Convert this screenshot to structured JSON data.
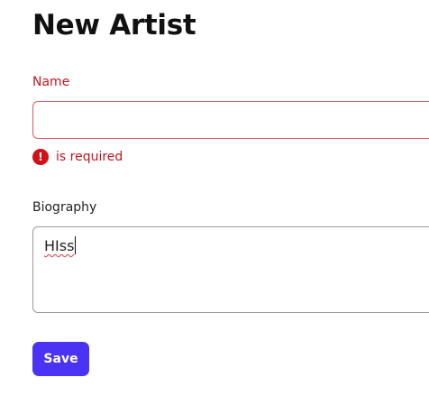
{
  "page": {
    "title": "New Artist"
  },
  "form": {
    "name": {
      "label": "Name",
      "value": "",
      "error": "is required"
    },
    "biography": {
      "label": "Biography",
      "value": "HIss"
    },
    "save_label": "Save"
  },
  "colors": {
    "error": "#c4151c",
    "accent": "#4b33f5"
  },
  "icons": {
    "error": "exclamation-circle-icon"
  }
}
